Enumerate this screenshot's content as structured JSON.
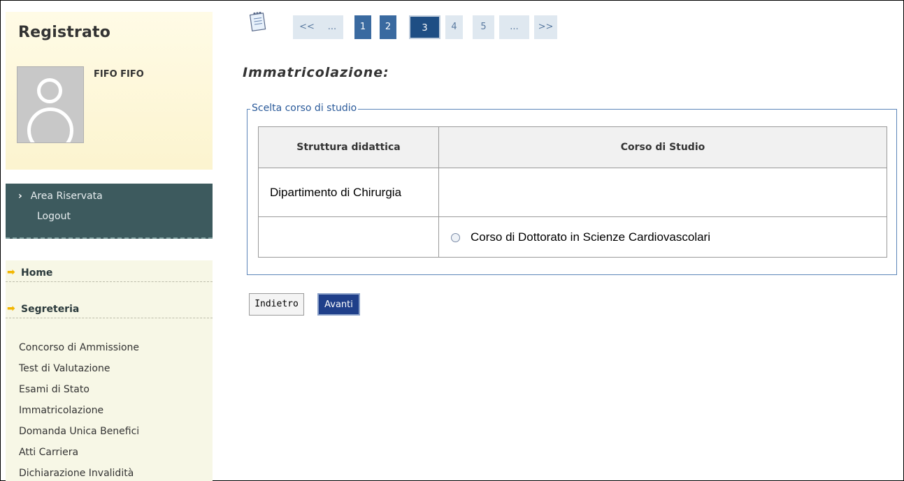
{
  "sidebar": {
    "title": "Registrato",
    "user_name": "FIFO FIFO",
    "reserved": {
      "items": [
        {
          "label": "Area Riservata"
        },
        {
          "label": "Logout"
        }
      ]
    },
    "menu": {
      "home": "Home",
      "segreteria": "Segreteria",
      "items": [
        "Concorso di Ammissione",
        "Test di Valutazione",
        "Esami di Stato",
        "Immatricolazione",
        "Domanda Unica Benefici",
        "Atti Carriera",
        "Dichiarazione Invalidità"
      ]
    }
  },
  "pager": {
    "first": "<<",
    "ellipsis_left": "...",
    "pages": [
      "1",
      "2",
      "3",
      "4",
      "5"
    ],
    "current": "3",
    "ellipsis_right": "...",
    "last": ">>"
  },
  "main": {
    "title": "Immatricolazione:",
    "fieldset_legend": "Scelta corso di studio",
    "table": {
      "headers": [
        "Struttura didattica",
        "Corso di Studio"
      ],
      "rows": [
        {
          "struttura": "Dipartimento di Chirurgia",
          "corso": ""
        },
        {
          "struttura": "",
          "corso": "Corso di Dottorato in Scienze Cardiovascolari"
        }
      ]
    },
    "buttons": {
      "back": "Indietro",
      "next": "Avanti"
    }
  }
}
